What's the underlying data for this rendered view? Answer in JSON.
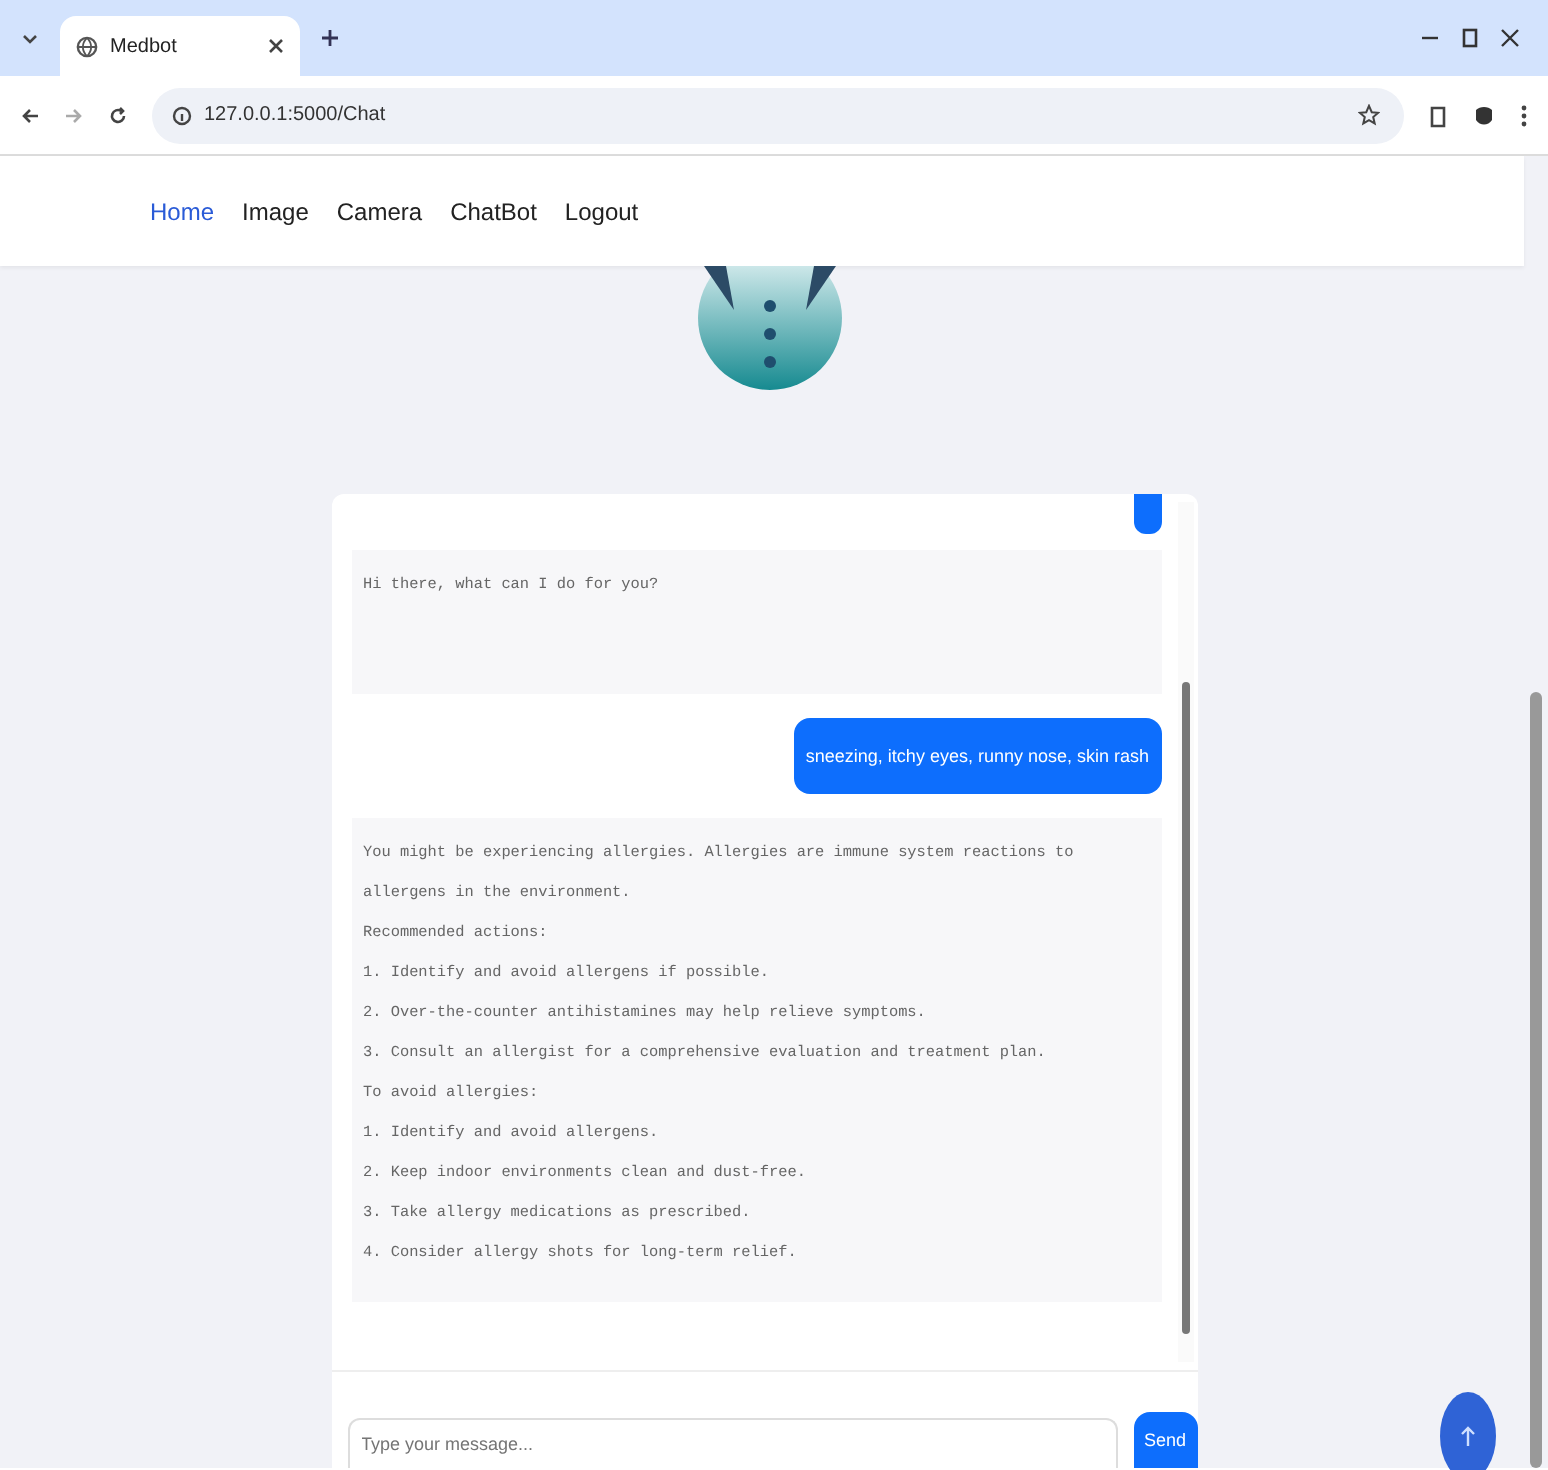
{
  "browser": {
    "tab_title": "Medbot",
    "url": "127.0.0.1:5000/Chat"
  },
  "nav": [
    {
      "label": "Home",
      "selected": true
    },
    {
      "label": "Image",
      "selected": false
    },
    {
      "label": "Camera",
      "selected": false
    },
    {
      "label": "ChatBot",
      "selected": false
    },
    {
      "label": "Logout",
      "selected": false
    }
  ],
  "chat": {
    "messages": [
      {
        "kind": "user",
        "clipped": true
      },
      {
        "kind": "bot",
        "lines": [
          "Hi there, what can I do for you?"
        ]
      },
      {
        "kind": "user",
        "text": "sneezing, itchy eyes, runny nose, skin rash"
      },
      {
        "kind": "bot",
        "lines": [
          "You might be experiencing allergies. Allergies are immune system reactions to allergens in the environment.",
          "Recommended actions:",
          "1. Identify and avoid allergens if possible.",
          "2. Over-the-counter antihistamines may help relieve symptoms.",
          "3. Consult an allergist for a comprehensive evaluation and treatment plan.",
          "To avoid allergies:",
          "1. Identify and avoid allergens.",
          "2. Keep indoor environments clean and dust-free.",
          "3. Take allergy medications as prescribed.",
          "4. Consider allergy shots for long-term relief."
        ]
      }
    ],
    "input": {
      "placeholder": "Type your message..."
    },
    "send_button": "Send"
  }
}
